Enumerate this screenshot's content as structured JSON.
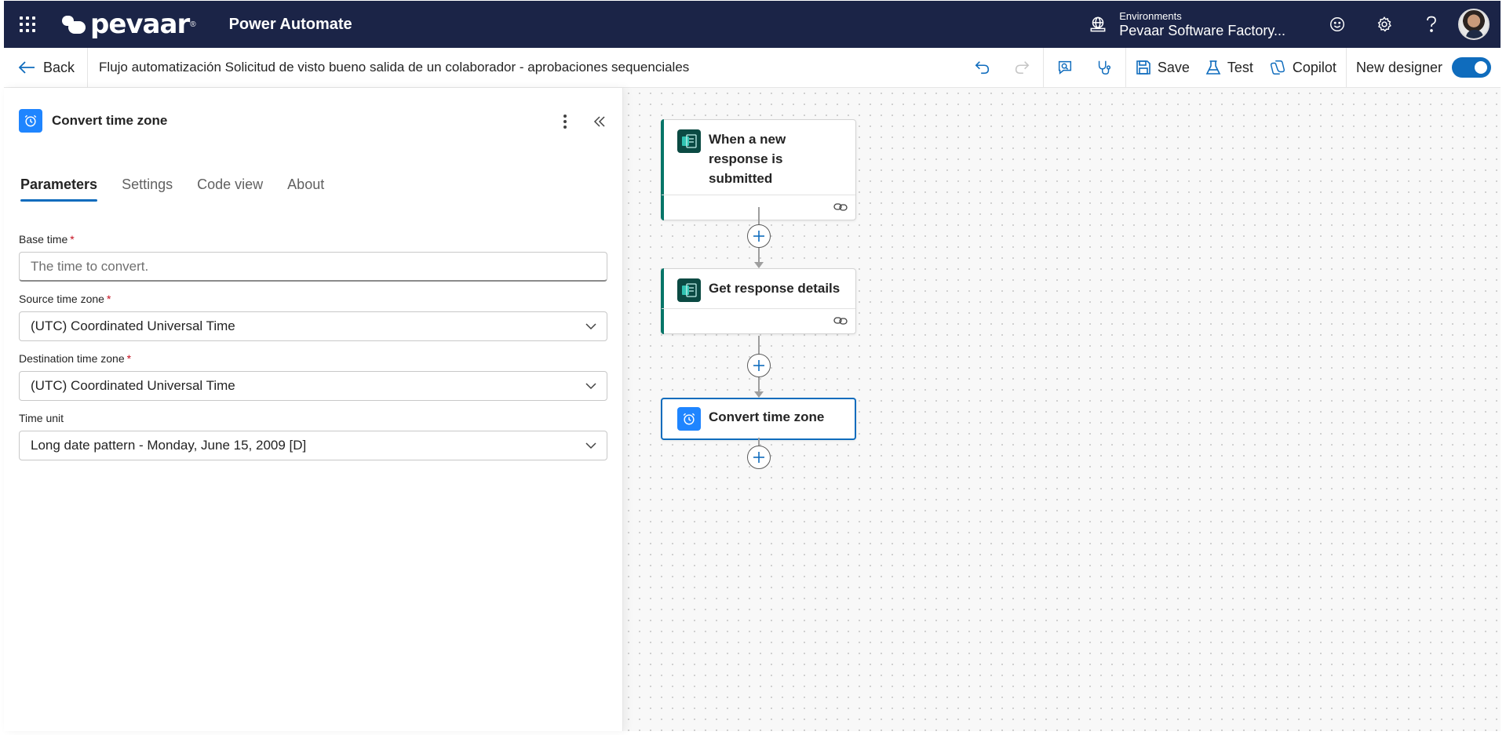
{
  "header": {
    "brand": "pevaar",
    "brand_reg": "®",
    "app_name": "Power Automate",
    "environment_label": "Environments",
    "environment_value": "Pevaar Software Factory..."
  },
  "commandbar": {
    "back_label": "Back",
    "flow_title": "Flujo automatización Solicitud de visto bueno salida de un colaborador - aprobaciones sequenciales",
    "save_label": "Save",
    "test_label": "Test",
    "copilot_label": "Copilot",
    "new_designer_label": "New designer",
    "new_designer_on": true
  },
  "panel": {
    "title": "Convert time zone",
    "tabs": [
      {
        "label": "Parameters",
        "active": true
      },
      {
        "label": "Settings",
        "active": false
      },
      {
        "label": "Code view",
        "active": false
      },
      {
        "label": "About",
        "active": false
      }
    ],
    "fields": {
      "base_time": {
        "label": "Base time",
        "required": "*",
        "placeholder": "The time to convert."
      },
      "source_tz": {
        "label": "Source time zone",
        "required": "*",
        "value": "(UTC) Coordinated Universal Time"
      },
      "dest_tz": {
        "label": "Destination time zone",
        "required": "*",
        "value": "(UTC) Coordinated Universal Time"
      },
      "time_unit": {
        "label": "Time unit",
        "value": "Long date pattern - Monday, June 15, 2009 [D]"
      }
    }
  },
  "flow": {
    "nodes": [
      {
        "title": "When a new response is submitted"
      },
      {
        "title": "Get response details"
      },
      {
        "title": "Convert time zone"
      }
    ]
  },
  "colors": {
    "header_bg": "#1b2447",
    "accent": "#0f6cbd",
    "forms_green": "#077568",
    "action_blue": "#1f85ff"
  }
}
